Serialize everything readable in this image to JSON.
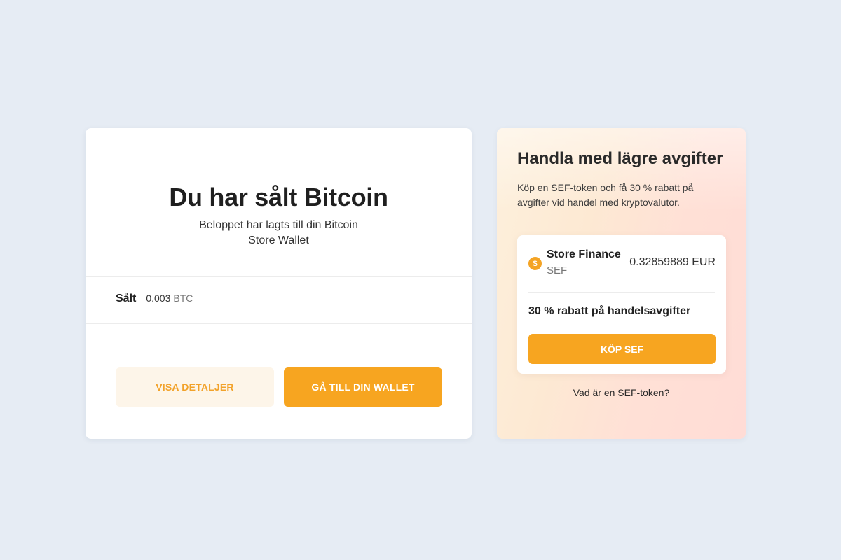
{
  "confirmation": {
    "title": "Du har sålt Bitcoin",
    "subtitle_line1": "Beloppet har lagts till din Bitcoin",
    "subtitle_line2": "Store Wallet",
    "sold_label": "Sålt",
    "sold_amount": "0.003",
    "sold_unit": "BTC",
    "details_button": "VISA DETALJER",
    "wallet_button": "GÅ TILL DIN WALLET"
  },
  "promo": {
    "title": "Handla med lägre avgifter",
    "description": "Köp en SEF-token och få 30 % rabatt på avgifter vid handel med kryptovalutor.",
    "token": {
      "icon": "coin-icon",
      "icon_glyph": "$",
      "name": "Store Finance",
      "symbol": "SEF",
      "price": "0.32859889 EUR"
    },
    "discount_text": "30 % rabatt på handelsavgifter",
    "buy_button": "KÖP SEF",
    "info_link": "Vad är en SEF-token?"
  },
  "colors": {
    "page_background": "#e6ecf4",
    "accent": "#f7a520",
    "secondary_button_bg": "#fdf5e9",
    "secondary_button_text": "#f2a22a"
  }
}
